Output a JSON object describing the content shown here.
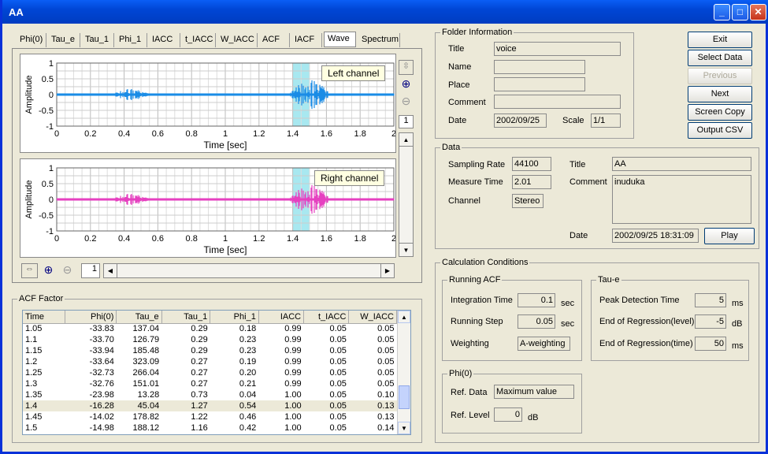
{
  "window": {
    "title": "AA",
    "btn_min": "_",
    "btn_max": "□",
    "btn_close": "✕"
  },
  "tabs": [
    "Phi(0)",
    "Tau_e",
    "Tau_1",
    "Phi_1",
    "IACC",
    "t_IACC",
    "W_IACC",
    "ACF",
    "IACF",
    "Wave",
    "Spectrum"
  ],
  "active_tab": "Wave",
  "plots": {
    "left": {
      "tooltip": "Left channel",
      "ylabel": "Amplitude",
      "xlabel": "Time [sec]",
      "color": "#1a8ce6"
    },
    "right": {
      "tooltip": "Right channel",
      "ylabel": "Amplitude",
      "xlabel": "Time [sec]",
      "color": "#e640c0"
    },
    "yticks": [
      "1",
      "0.5",
      "0",
      "-0.5",
      "-1"
    ],
    "xticks": [
      "0",
      "0.2",
      "0.4",
      "0.6",
      "0.8",
      "1",
      "1.2",
      "1.4",
      "1.6",
      "1.8",
      "2"
    ],
    "highlight_range": [
      1.4,
      1.5
    ],
    "page_box": "1",
    "hscroll_box": "1"
  },
  "folder": {
    "label": "Folder Information",
    "title_lbl": "Title",
    "title": "voice",
    "name_lbl": "Name",
    "name": "",
    "place_lbl": "Place",
    "place": "",
    "comment_lbl": "Comment",
    "comment": "",
    "date_lbl": "Date",
    "date": "2002/09/25",
    "scale_lbl": "Scale",
    "scale": "1/1"
  },
  "buttons": {
    "exit": "Exit",
    "select_data": "Select Data",
    "previous": "Previous",
    "next": "Next",
    "screen_copy": "Screen Copy",
    "output_csv": "Output CSV",
    "play": "Play"
  },
  "data": {
    "label": "Data",
    "sr_lbl": "Sampling Rate",
    "sr": "44100",
    "mt_lbl": "Measure Time",
    "mt": "2.01",
    "ch_lbl": "Channel",
    "ch": "Stereo",
    "title_lbl": "Title",
    "title": "AA",
    "comment_lbl": "Comment",
    "comment": "inuduka",
    "date_lbl": "Date",
    "date": "2002/09/25 18:31:09"
  },
  "calc": {
    "label": "Calculation Conditions",
    "running": {
      "label": "Running ACF",
      "it_lbl": "Integration Time",
      "it": "0.1",
      "it_unit": "sec",
      "rs_lbl": "Running Step",
      "rs": "0.05",
      "rs_unit": "sec",
      "w_lbl": "Weighting",
      "w": "A-weighting"
    },
    "taue": {
      "label": "Tau-e",
      "pd_lbl": "Peak Detection Time",
      "pd": "5",
      "pd_unit": "ms",
      "erl_lbl": "End of Regression(level)",
      "erl": "-5",
      "erl_unit": "dB",
      "ert_lbl": "End of Regression(time)",
      "ert": "50",
      "ert_unit": "ms"
    },
    "phi0": {
      "label": "Phi(0)",
      "rd_lbl": "Ref. Data",
      "rd": "Maximum value",
      "rl_lbl": "Ref. Level",
      "rl": "0",
      "rl_unit": "dB"
    }
  },
  "acf": {
    "label": "ACF Factor",
    "columns": [
      "Time",
      "Phi(0)",
      "Tau_e",
      "Tau_1",
      "Phi_1",
      "IACC",
      "t_IACC",
      "W_IACC"
    ],
    "rows": [
      [
        "1.05",
        "-33.83",
        "137.04",
        "0.29",
        "0.18",
        "0.99",
        "0.05",
        "0.05"
      ],
      [
        "1.1",
        "-33.70",
        "126.79",
        "0.29",
        "0.23",
        "0.99",
        "0.05",
        "0.05"
      ],
      [
        "1.15",
        "-33.94",
        "185.48",
        "0.29",
        "0.23",
        "0.99",
        "0.05",
        "0.05"
      ],
      [
        "1.2",
        "-33.64",
        "323.09",
        "0.27",
        "0.19",
        "0.99",
        "0.05",
        "0.05"
      ],
      [
        "1.25",
        "-32.73",
        "266.04",
        "0.27",
        "0.20",
        "0.99",
        "0.05",
        "0.05"
      ],
      [
        "1.3",
        "-32.76",
        "151.01",
        "0.27",
        "0.21",
        "0.99",
        "0.05",
        "0.05"
      ],
      [
        "1.35",
        "-23.98",
        "13.28",
        "0.73",
        "0.04",
        "1.00",
        "0.05",
        "0.10"
      ],
      [
        "1.4",
        "-16.28",
        "45.04",
        "1.27",
        "0.54",
        "1.00",
        "0.05",
        "0.13"
      ],
      [
        "1.45",
        "-14.02",
        "178.82",
        "1.22",
        "0.46",
        "1.00",
        "0.05",
        "0.13"
      ],
      [
        "1.5",
        "-14.98",
        "188.12",
        "1.16",
        "0.42",
        "1.00",
        "0.05",
        "0.14"
      ]
    ],
    "selected_row": 7
  }
}
